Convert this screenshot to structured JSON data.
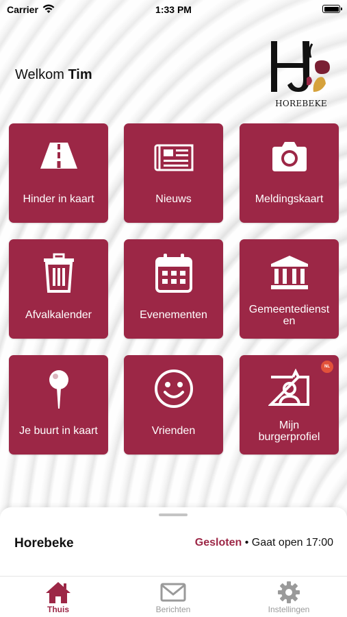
{
  "status_bar": {
    "carrier": "Carrier",
    "time": "1:33 PM"
  },
  "header": {
    "welcome_prefix": "Welkom",
    "user_name": "Tim",
    "logo_name": "HOREBEKE"
  },
  "tiles": [
    {
      "label": "Hinder in kaart",
      "icon": "road-icon"
    },
    {
      "label": "Nieuws",
      "icon": "newspaper-icon"
    },
    {
      "label": "Meldingskaart",
      "icon": "camera-icon"
    },
    {
      "label": "Afvalkalender",
      "icon": "trash-icon"
    },
    {
      "label": "Evenementen",
      "icon": "calendar-icon"
    },
    {
      "label": "Gemeentedienst en",
      "label_line1": "Gemeentedienst",
      "label_line2": "en",
      "icon": "town-hall-icon"
    },
    {
      "label": "Je buurt in kaart",
      "icon": "map-pin-icon"
    },
    {
      "label": "Vrienden",
      "icon": "smiley-icon"
    },
    {
      "label": "Mijn burgerprofiel",
      "label_line1": "Mijn",
      "label_line2": "burgerprofiel",
      "icon": "profile-id-icon",
      "badge": "NL"
    }
  ],
  "sheet": {
    "place": "Horebeke",
    "status": "Gesloten",
    "separator": "•",
    "opens": "Gaat open 17:00"
  },
  "tabbar": [
    {
      "label": "Thuis",
      "icon": "home-icon",
      "active": true
    },
    {
      "label": "Berichten",
      "icon": "mail-icon",
      "active": false
    },
    {
      "label": "Instellingen",
      "icon": "gear-icon",
      "active": false
    }
  ],
  "colors": {
    "accent": "#9c2746",
    "tile_text": "#ffffff",
    "inactive_tab": "#9a9a9a"
  }
}
